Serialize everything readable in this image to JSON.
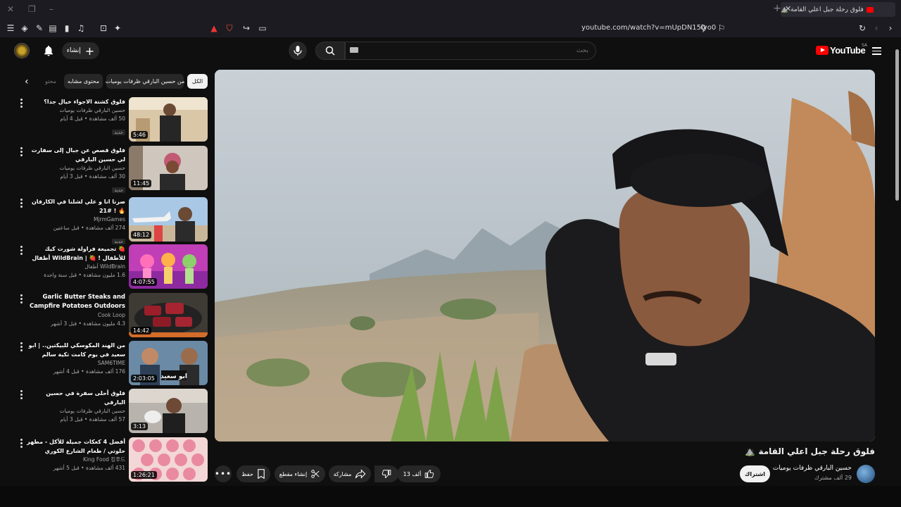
{
  "browser": {
    "tab_title": "فلوق رحلة جبل اعلي القامة ⛰️",
    "url": "youtube.com/watch?v=mUpDN15iyo0"
  },
  "header": {
    "create_label": "إنشاء",
    "search_placeholder": "بحث",
    "logo_text": "YouTube",
    "country_code": "SA"
  },
  "chips": [
    {
      "label": "الكل",
      "active": true
    },
    {
      "label": "من حسين البارقي ظرفات يوميات",
      "active": false
    },
    {
      "label": "محتوى مشابه",
      "active": false
    },
    {
      "label": "محتو",
      "active": false
    }
  ],
  "recommendations": [
    {
      "title": "فلوق كشتة الاجواء خيال جدا؟",
      "channel": "حسين البارقي ظرفات يوميات",
      "meta": "50 ألف مشاهدة • قبل 4 أيام",
      "badge": "جديد",
      "duration": "5:46"
    },
    {
      "title": "فلوق قصص عن جبال إلى سفارت لي حسين البارقي",
      "channel": "حسين البارقي ظرفات يوميات",
      "meta": "30 ألف مشاهدة • قبل 3 أيام",
      "badge": "جديد",
      "duration": "11:45"
    },
    {
      "title": "صرنا انا و علي لشلنا في الكارفان 🔥 ! #21",
      "channel": "MjrmGames",
      "meta": "274 ألف مشاهدة • قبل ساعتين",
      "badge": "جديد",
      "duration": "48:12"
    },
    {
      "title": "🍓 تجميعة فراولة شورت كيك للأطفال ! 🍓 | WildBrain أطفال",
      "channel": "WildBrain أطفال",
      "meta": "1.6 مليون مشاهدة • قبل سنة واحدة",
      "badge": "",
      "duration": "4:07:55"
    },
    {
      "title": "Garlic Butter Steaks and Campfire Potatoes Outdoors",
      "channel": "Cook Loop",
      "meta": "4.3 مليون مشاهدة • قبل 3 أشهر",
      "badge": "",
      "duration": "14:42"
    },
    {
      "title": "من الهند المكوسكي للبيكتين.. | ابو سعيد في يوم كامت تكية سالم",
      "channel": "SAM6TIME",
      "meta": "176 ألف مشاهدة • قبل 4 أشهر",
      "badge": "",
      "duration": "2:03:05"
    },
    {
      "title": "فلوق أحلى سفرة في حسين البارقي",
      "channel": "حسين البارقي ظرفات يوميات",
      "meta": "57 ألف مشاهدة • قبل 3 أيام",
      "badge": "",
      "duration": "3:13"
    },
    {
      "title": "أفضل 4 كعكات جميلة للأكل - مطهر حلوتي / طعام الشارع الكوري",
      "channel": "King Food 킹푸드",
      "meta": "431 ألف مشاهدة • قبل 5 أشهر",
      "badge": "",
      "duration": "1:26:21"
    }
  ],
  "video": {
    "title": "فلوق رحلة جبل اعلي القامة ⛰️",
    "channel_name": "حسين البارقي ظرفات يوميات",
    "subscribers": "29 ألف مشترك",
    "subscribe_label": "اشتراك",
    "like_count": "13 ألف",
    "share_label": "مشاركة",
    "clip_label": "إنشاء مقطع",
    "save_label": "حفظ"
  },
  "colors": {
    "background": "#0f0f0f",
    "brand_red": "#ff0000",
    "chip_bg": "#272727"
  }
}
